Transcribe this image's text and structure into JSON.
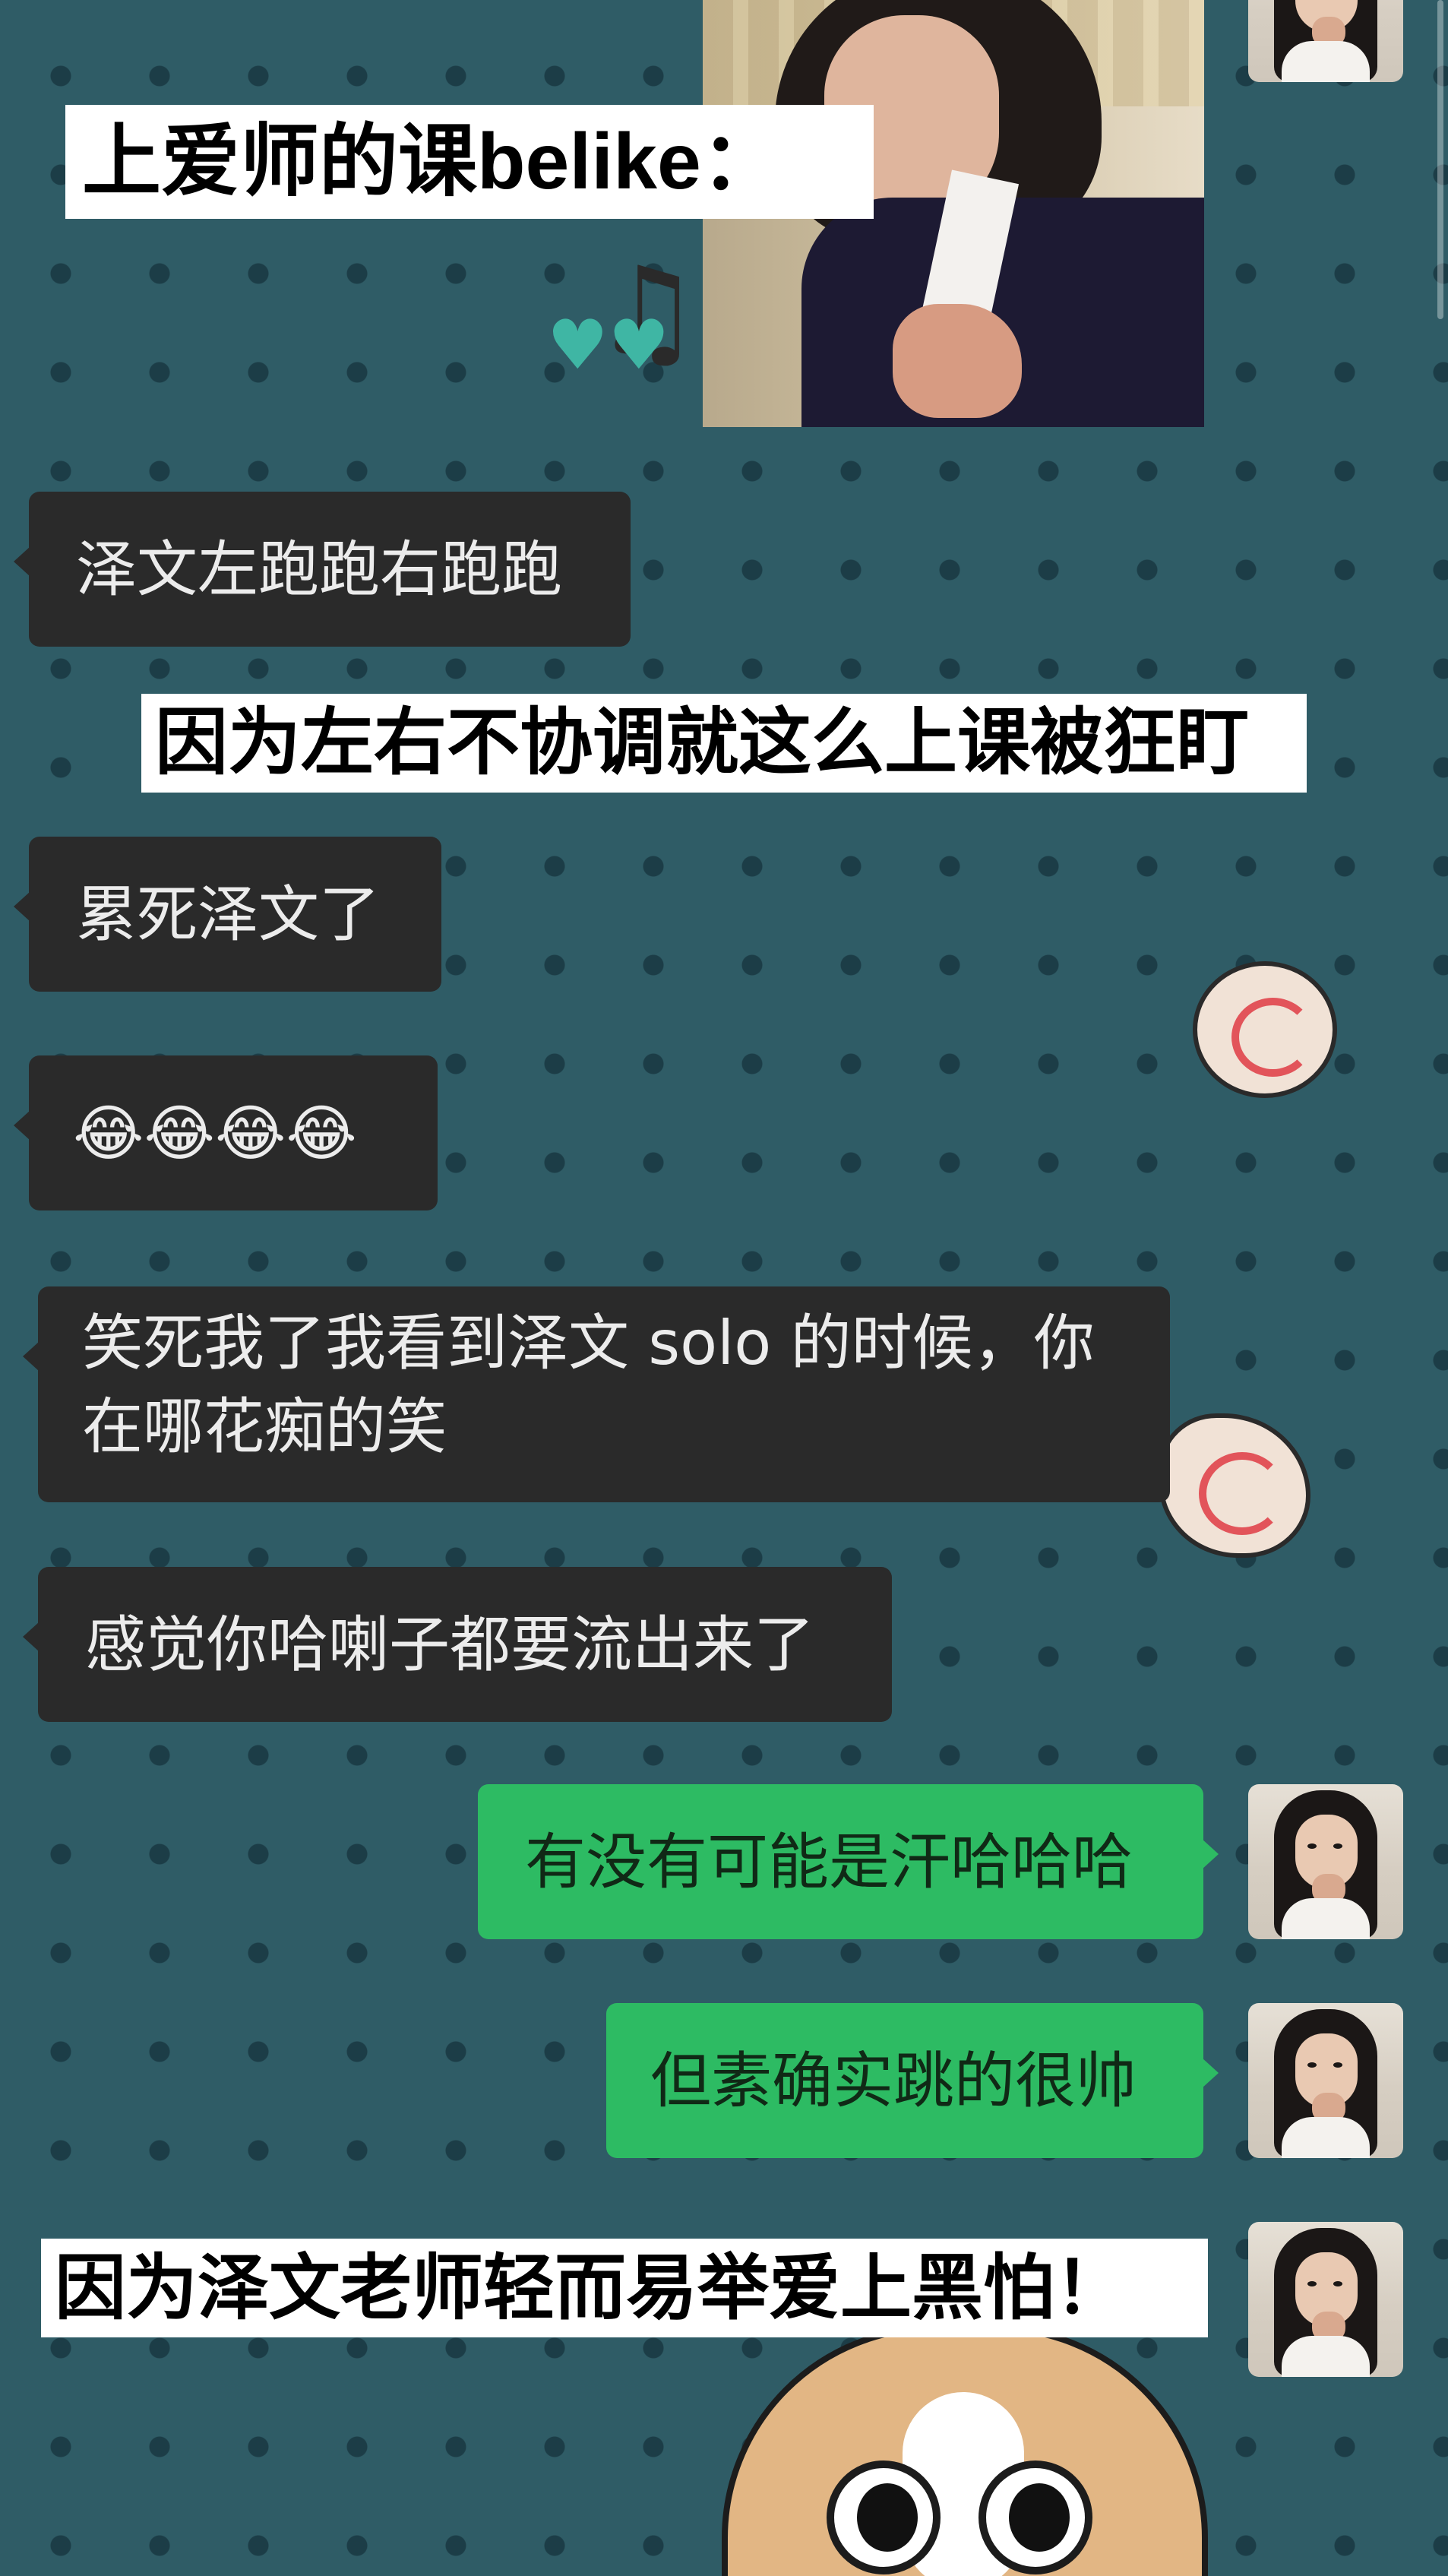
{
  "colors": {
    "background": "#2f5c66",
    "incoming_bubble": "#2a2a2a",
    "outgoing_bubble": "#2dbb63",
    "caption_background": "#ffffff"
  },
  "captions": {
    "top": "上爱师的课belike：",
    "middle": "因为左右不协调就这么上课被狂盯",
    "bottom": "因为泽文老师轻而易举爱上黑怕！"
  },
  "messages": [
    {
      "side": "in",
      "text": "泽文左跑跑右跑跑"
    },
    {
      "side": "in",
      "text": "累死泽文了"
    },
    {
      "side": "in",
      "text": "😂😂😂😂"
    },
    {
      "side": "in",
      "text": " 笑死我了我看到泽文 solo 的时候，你在哪花痴的笑"
    },
    {
      "side": "in",
      "text": "感觉你哈喇子都要流出来了"
    },
    {
      "side": "out",
      "text": "有没有可能是汗哈哈哈"
    },
    {
      "side": "out",
      "text": "但素确实跳的很帅"
    }
  ],
  "stickers": {
    "photo": "woman-laughing-photo",
    "cartoon": "cartoon-dog-sticker"
  }
}
